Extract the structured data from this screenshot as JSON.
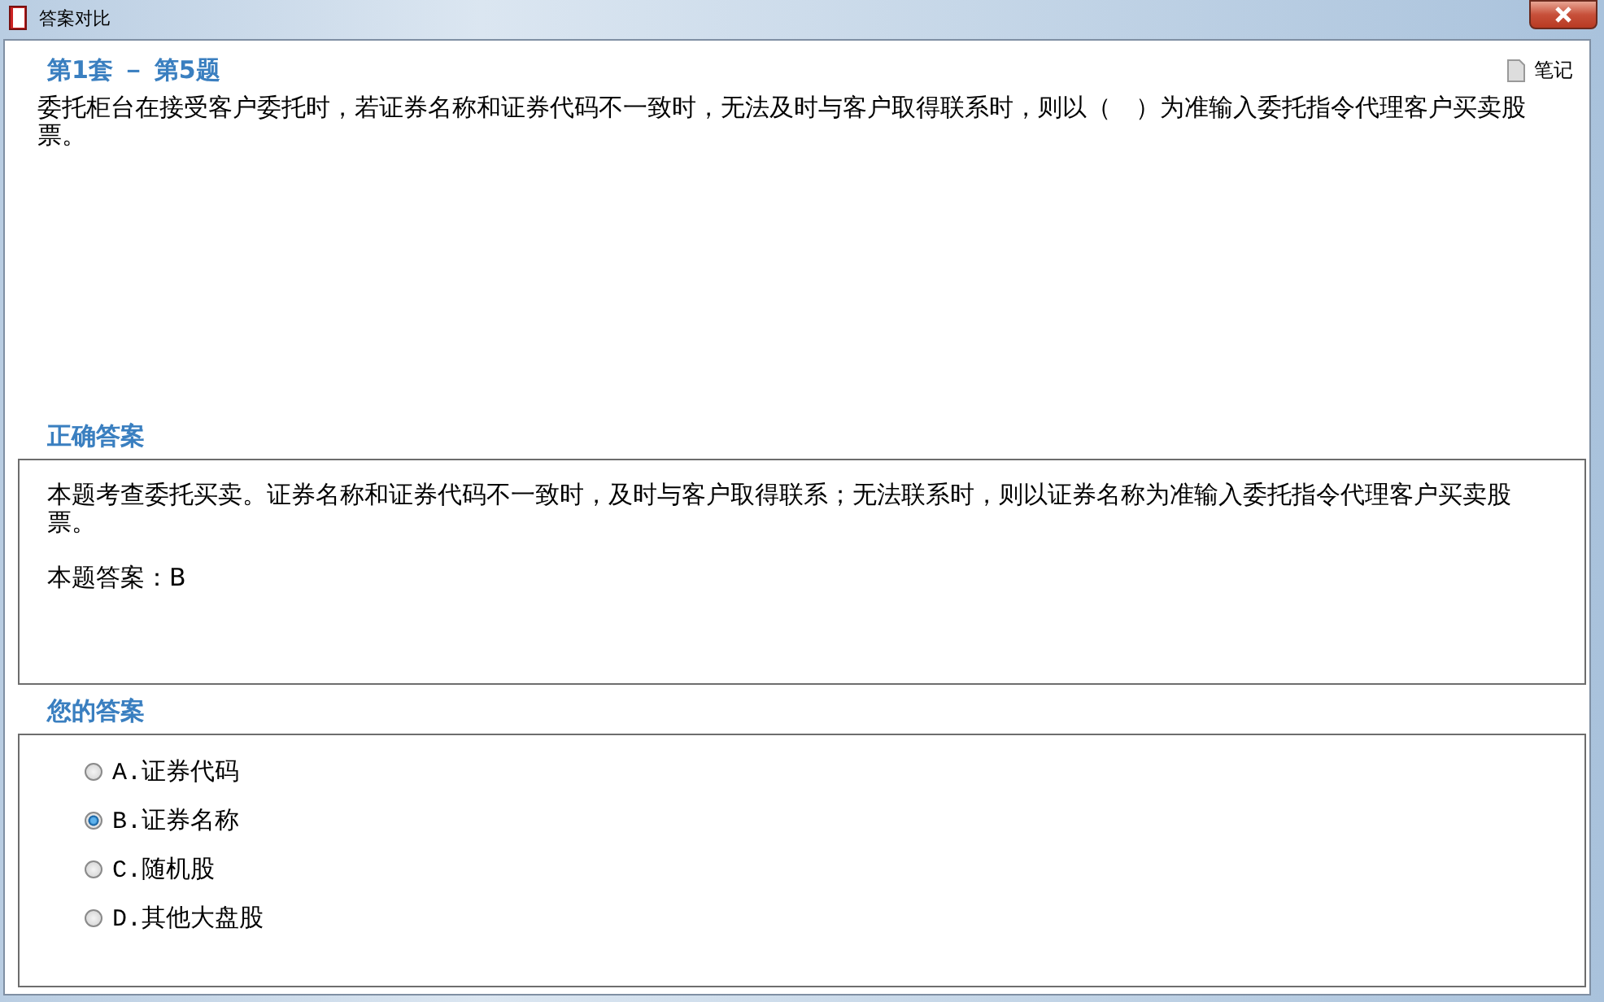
{
  "window": {
    "title": "答案对比"
  },
  "question": {
    "heading": "第1套 － 第5题",
    "notes_label": "笔记",
    "text": "委托柜台在接受客户委托时，若证券名称和证券代码不一致时，无法及时与客户取得联系时，则以（　）为准输入委托指令代理客户买卖股票。"
  },
  "correct_answer": {
    "heading": "正确答案",
    "explanation": "本题考查委托买卖。证券名称和证券代码不一致时，及时与客户取得联系；无法联系时，则以证券名称为准输入委托指令代理客户买卖股票。",
    "answer": "本题答案：B"
  },
  "your_answer": {
    "heading": "您的答案",
    "options": [
      {
        "letter": "A.",
        "text": "证券代码",
        "selected": false
      },
      {
        "letter": "B.",
        "text": "证券名称",
        "selected": true
      },
      {
        "letter": "C.",
        "text": "随机股",
        "selected": false
      },
      {
        "letter": "D.",
        "text": "其他大盘股",
        "selected": false
      }
    ]
  }
}
